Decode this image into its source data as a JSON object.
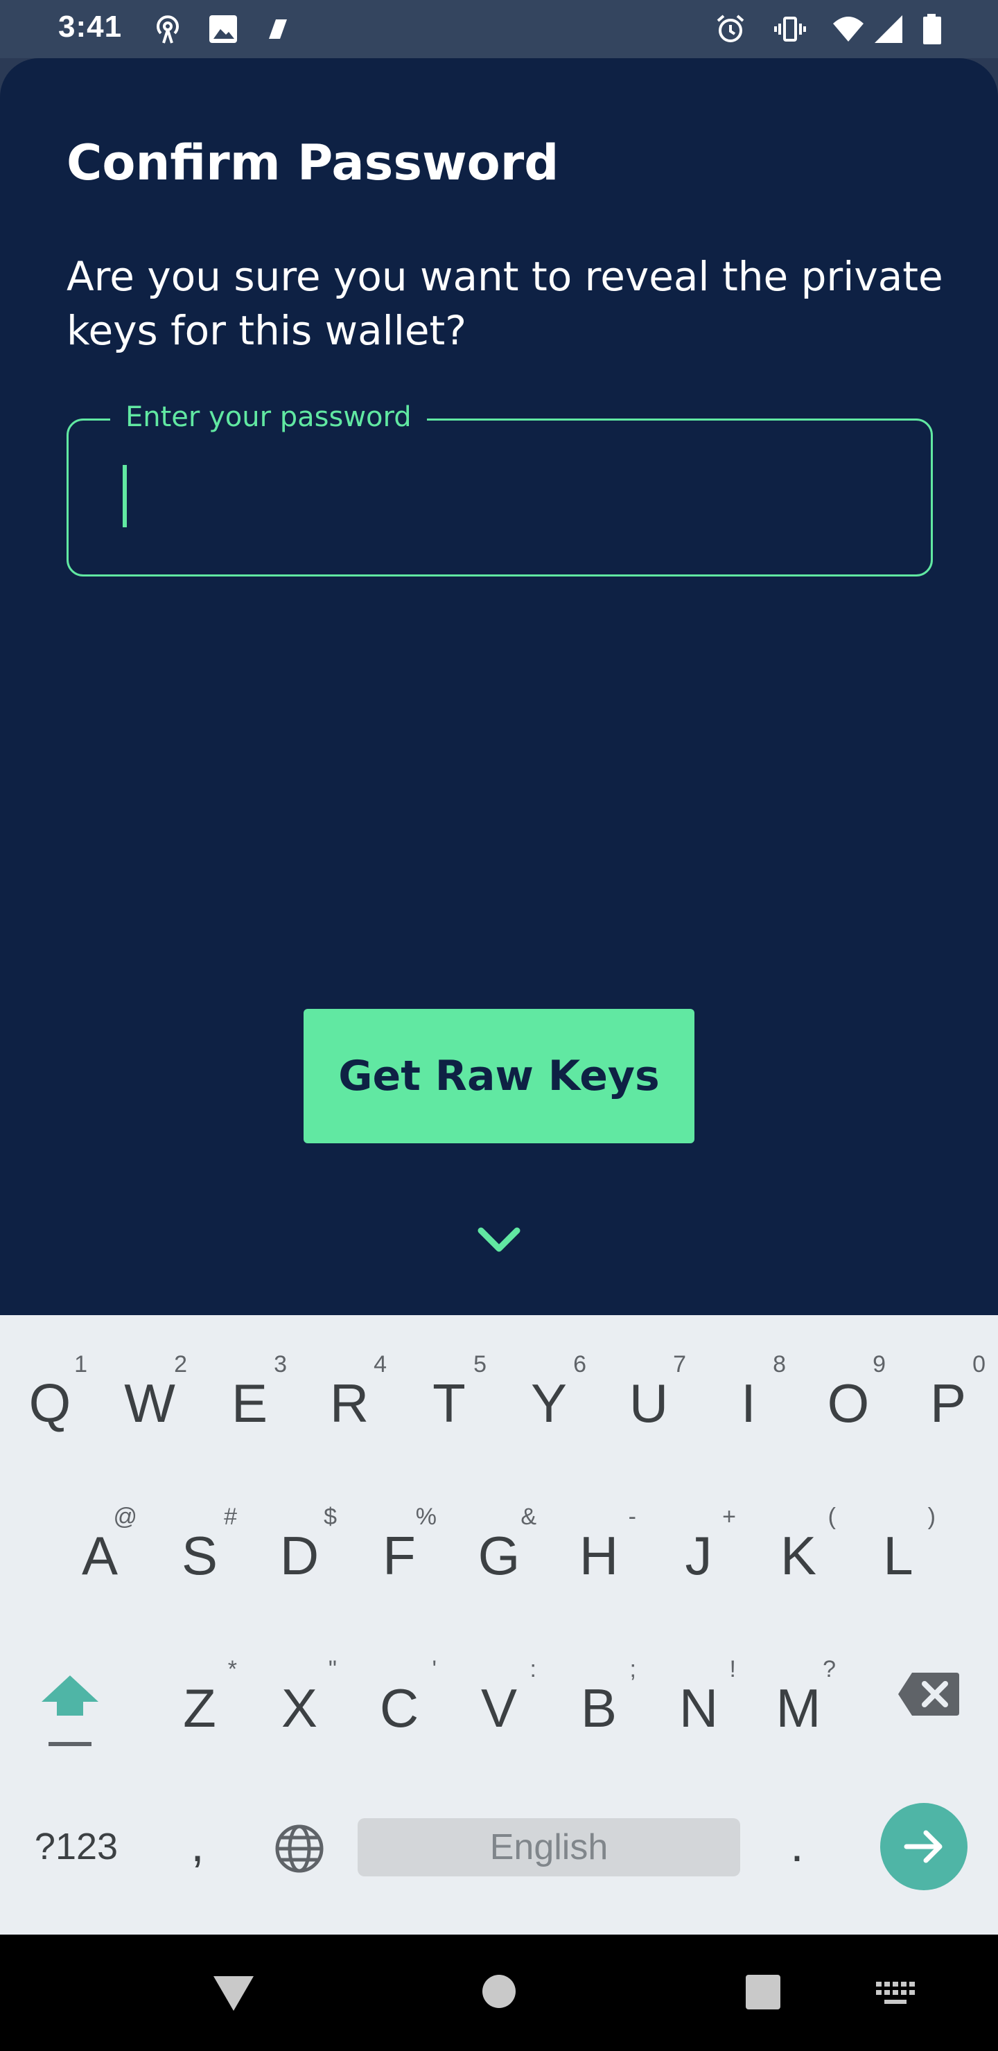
{
  "status_bar": {
    "time": "3:41",
    "icons": [
      "hotspot-icon",
      "image-icon",
      "app-icon",
      "alarm-icon",
      "vibrate-icon",
      "wifi-icon",
      "signal-icon",
      "battery-icon"
    ]
  },
  "dialog": {
    "title": "Confirm Password",
    "question": "Are you sure you want to reveal the private keys for this wallet?",
    "password_field": {
      "label": "Enter your password",
      "value": ""
    },
    "primary_button": "Get Raw Keys",
    "collapse_icon": "chevron-down-icon"
  },
  "keyboard": {
    "row1": [
      {
        "k": "Q",
        "h": "1"
      },
      {
        "k": "W",
        "h": "2"
      },
      {
        "k": "E",
        "h": "3"
      },
      {
        "k": "R",
        "h": "4"
      },
      {
        "k": "T",
        "h": "5"
      },
      {
        "k": "Y",
        "h": "6"
      },
      {
        "k": "U",
        "h": "7"
      },
      {
        "k": "I",
        "h": "8"
      },
      {
        "k": "O",
        "h": "9"
      },
      {
        "k": "P",
        "h": "0"
      }
    ],
    "row2": [
      {
        "k": "A",
        "h": "@"
      },
      {
        "k": "S",
        "h": "#"
      },
      {
        "k": "D",
        "h": "$"
      },
      {
        "k": "F",
        "h": "%"
      },
      {
        "k": "G",
        "h": "&"
      },
      {
        "k": "H",
        "h": "-"
      },
      {
        "k": "J",
        "h": "+"
      },
      {
        "k": "K",
        "h": "("
      },
      {
        "k": "L",
        "h": ")"
      }
    ],
    "row3": [
      {
        "k": "Z",
        "h": "*"
      },
      {
        "k": "X",
        "h": "\""
      },
      {
        "k": "C",
        "h": "'"
      },
      {
        "k": "V",
        "h": ":"
      },
      {
        "k": "B",
        "h": ";"
      },
      {
        "k": "N",
        "h": "!"
      },
      {
        "k": "M",
        "h": "?"
      }
    ],
    "symbols_key": "?123",
    "comma_key": ",",
    "period_key": ".",
    "space_label": "English"
  },
  "colors": {
    "accent": "#61e8a2",
    "background": "#0e2144",
    "keyboard_action": "#4fb5a6"
  }
}
